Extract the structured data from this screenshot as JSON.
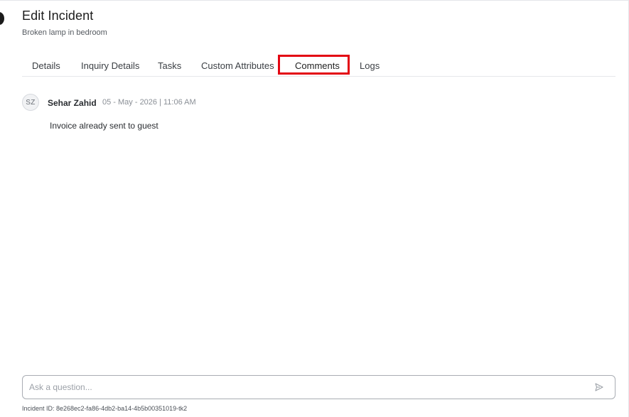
{
  "header": {
    "title": "Edit Incident",
    "subtitle": "Broken lamp in bedroom"
  },
  "tabs": [
    {
      "label": "Details"
    },
    {
      "label": "Inquiry Details"
    },
    {
      "label": "Tasks"
    },
    {
      "label": "Custom Attributes"
    },
    {
      "label": "Comments",
      "active": true
    },
    {
      "label": "Logs"
    }
  ],
  "comments": [
    {
      "avatar_initials": "SZ",
      "author": "Sehar Zahid",
      "timestamp": "05 - May - 2026 | 11:06 AM",
      "text": "Invoice already sent to guest"
    }
  ],
  "composer": {
    "placeholder": "Ask a question...",
    "value": "",
    "send_icon": "send-icon"
  },
  "footer": {
    "incident_id": "Incident ID: 8e268ec2-fa86-4db2-ba14-4b5b00351019-tk2"
  },
  "colors": {
    "highlight": "#e30613",
    "border": "#a9adb3"
  }
}
